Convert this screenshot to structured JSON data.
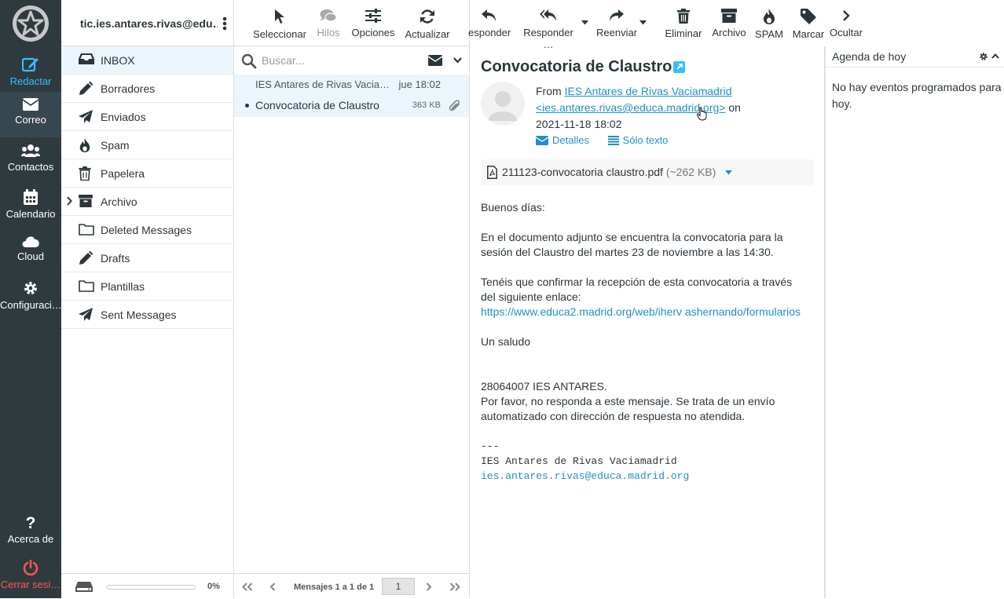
{
  "rail": {
    "compose": "Redactar",
    "mail": "Correo",
    "contacts": "Contactos",
    "calendar": "Calendario",
    "cloud": "Cloud",
    "settings": "Configuraci…",
    "about": "Acerca de",
    "logout": "Cerrar sesi…"
  },
  "account": "tic.ies.antares.rivas@edu…",
  "folders": [
    {
      "label": "INBOX",
      "icon": "inbox-icon"
    },
    {
      "label": "Borradores",
      "icon": "pencil-icon"
    },
    {
      "label": "Enviados",
      "icon": "paper-plane-icon"
    },
    {
      "label": "Spam",
      "icon": "fire-icon"
    },
    {
      "label": "Papelera",
      "icon": "trash-icon"
    },
    {
      "label": "Archivo",
      "icon": "archive-icon"
    },
    {
      "label": "Deleted Messages",
      "icon": "folder-icon"
    },
    {
      "label": "Drafts",
      "icon": "pencil-icon"
    },
    {
      "label": "Plantillas",
      "icon": "folder-icon"
    },
    {
      "label": "Sent Messages",
      "icon": "paper-plane-icon"
    }
  ],
  "quota": {
    "text": "0%",
    "value": 0
  },
  "search": {
    "placeholder": "Buscar..."
  },
  "message": {
    "from": "IES Antares de Rivas Vaciam…",
    "date": "jue 18:02",
    "subject": "Convocatoria de Claustro",
    "size": "363 KB"
  },
  "list_footer": {
    "count": "Mensajes 1 a 1 de 1",
    "page": "1"
  },
  "toolbar": {
    "select": "Seleccionar",
    "threads": "Hilos",
    "options": "Opciones",
    "refresh": "Actualizar",
    "reply": "esponder",
    "reply_all": "Responder …",
    "forward": "Reenviar",
    "delete": "Eliminar",
    "archive": "Archivo",
    "spam": "SPAM",
    "mark": "Marcar",
    "hide": "Ocultar"
  },
  "reader": {
    "subject": "Convocatoria de Claustro",
    "from_label": "From",
    "from_name": "IES Antares de Rivas Vaciamadrid",
    "from_email": "<ies.antares.rivas@educa.madrid.org>",
    "on": "on",
    "datetime": "2021-11-18 18:02",
    "details": "Detalles",
    "plain": "Sólo texto",
    "attachment_name": "211123-convocatoria claustro.pdf",
    "attachment_size": "(~262 KB)",
    "body": {
      "greeting": "Buenos días:",
      "p1_l1": "En el documento adjunto se encuentra la convocatoria para la",
      "p1_l2": "sesión del Claustro del martes 23 de noviembre a las 14:30.",
      "p2_l1": "Tenéis que confirmar la recepción de esta convocatoria a través",
      "p2_l2": "del siguiente enlace:",
      "url": "https://www.educa2.madrid.org/web/iherv ashernando/formularios",
      "closing": "Un saludo",
      "code": "28064007  IES ANTARES.",
      "note_l1": "Por favor, no responda a este mensaje. Se trata de un envío",
      "note_l2": "automatizado con dirección de respuesta no atendida.",
      "sig_sep": "---",
      "sig_name": "IES Antares de Rivas Vaciamadrid",
      "sig_email": "ies.antares.rivas@educa.madrid.org"
    }
  },
  "agenda": {
    "title": "Agenda de hoy",
    "empty": "No hay eventos programados para hoy."
  },
  "colors": {
    "rail_bg": "#2f3a3f",
    "accent": "#37beff",
    "link": "#1e90c8",
    "selected": "#eaf6fc",
    "logout": "#ff5552"
  }
}
